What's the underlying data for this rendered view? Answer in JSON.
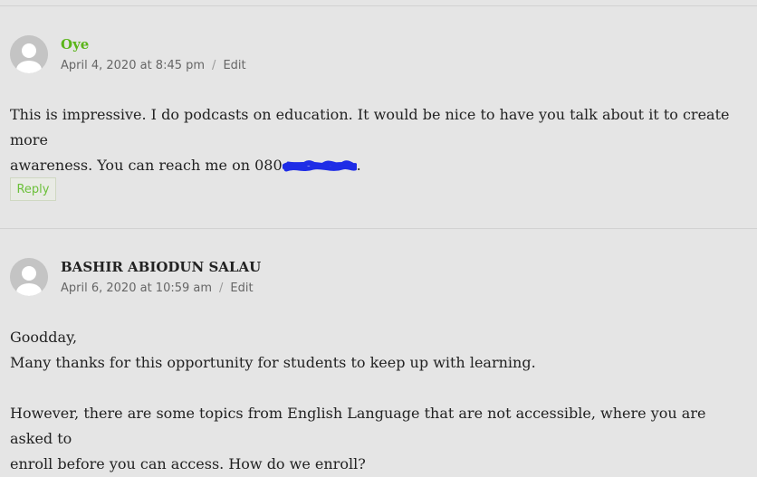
{
  "comments": [
    {
      "author": "Oye",
      "date": "April 4, 2020 at 8:45 pm",
      "separator": "/",
      "edit_label": "Edit",
      "body_line1": "This is impressive. I do podcasts on education. It would be nice to have you talk about it to create more",
      "body_line2_prefix": "awareness. You can reach me on 080",
      "body_line2_suffix": ".",
      "redaction_icon": "blue-scribble-redaction",
      "reply_label": "Reply"
    },
    {
      "author": "BASHIR ABIODUN SALAU",
      "date": "April 6, 2020 at 10:59 am",
      "separator": "/",
      "edit_label": "Edit",
      "body_p1_line1": "Goodday,",
      "body_p1_line2": "Many thanks for this opportunity for students to keep up with learning.",
      "body_p2_line1": "However, there are some topics from English Language that are not accessible, where you are asked to",
      "body_p2_line2": "enroll before you can access. How do we enroll?"
    }
  ],
  "colors": {
    "background": "#e5e5e5",
    "accent_green": "#5bb51a",
    "redaction_blue": "#1f2de6",
    "avatar_gray": "#c4c4c4"
  }
}
